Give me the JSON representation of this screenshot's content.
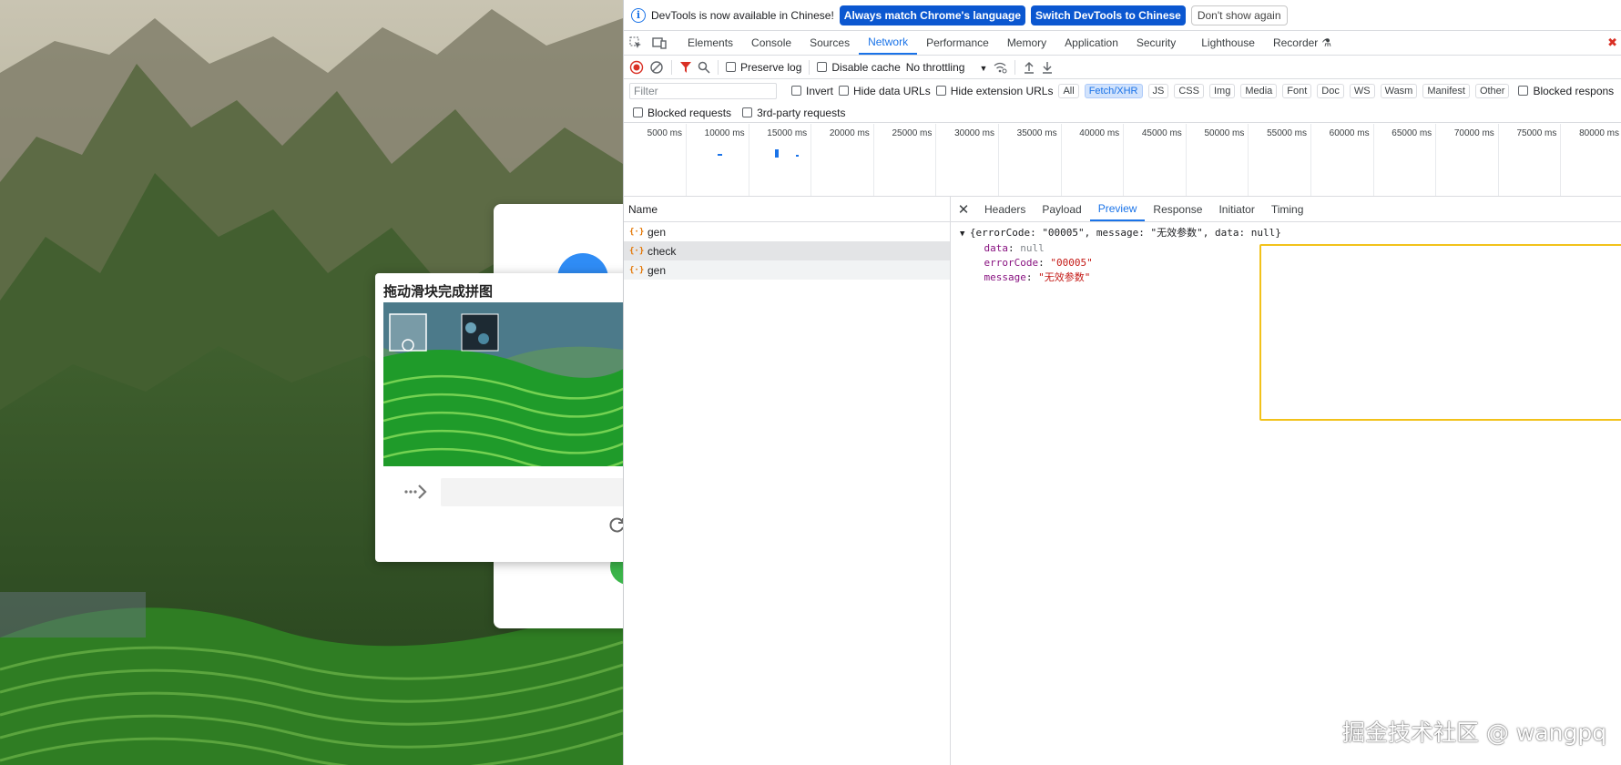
{
  "captcha": {
    "title": "拖动滑块完成拼图"
  },
  "infobar": {
    "message": "DevTools is now available in Chinese!",
    "match_button": "Always match Chrome's language",
    "switch_button": "Switch DevTools to Chinese",
    "dismiss_button": "Don't show again"
  },
  "tabs": [
    "Elements",
    "Console",
    "Sources",
    "Network",
    "Performance",
    "Memory",
    "Application",
    "Security",
    "Lighthouse",
    "Recorder"
  ],
  "active_tab": "Network",
  "toolbar": {
    "preserve_log": "Preserve log",
    "disable_cache": "Disable cache",
    "throttling": "No throttling"
  },
  "filter": {
    "placeholder": "Filter",
    "invert": "Invert",
    "hide_data_urls": "Hide data URLs",
    "hide_extension_urls": "Hide extension URLs",
    "types": [
      "All",
      "Fetch/XHR",
      "JS",
      "CSS",
      "Img",
      "Media",
      "Font",
      "Doc",
      "WS",
      "Wasm",
      "Manifest",
      "Other"
    ],
    "active_type": "Fetch/XHR",
    "blocked_responses": "Blocked respons",
    "blocked_requests": "Blocked requests",
    "third_party": "3rd-party requests"
  },
  "timeline": {
    "labels": [
      "5000 ms",
      "10000 ms",
      "15000 ms",
      "20000 ms",
      "25000 ms",
      "30000 ms",
      "35000 ms",
      "40000 ms",
      "45000 ms",
      "50000 ms",
      "55000 ms",
      "60000 ms",
      "65000 ms",
      "70000 ms",
      "75000 ms",
      "80000 ms"
    ]
  },
  "requests": {
    "header": "Name",
    "items": [
      {
        "name": "gen"
      },
      {
        "name": "check"
      },
      {
        "name": "gen"
      }
    ]
  },
  "detail": {
    "tabs": [
      "Headers",
      "Payload",
      "Preview",
      "Response",
      "Initiator",
      "Timing"
    ],
    "active": "Preview",
    "summary": "{errorCode: \"00005\", message: \"无效参数\", data: null}",
    "data_key": "data",
    "data_val": "null",
    "error_key": "errorCode",
    "error_val": "\"00005\"",
    "message_key": "message",
    "message_val": "\"无效参数\""
  },
  "watermark": "掘金技术社区 @ wangpq",
  "colors": {
    "accent": "#1a73e8",
    "primary_button": "#0b57d0",
    "highlight_box": "#f2c21a",
    "xhr_icon": "#e37400"
  }
}
